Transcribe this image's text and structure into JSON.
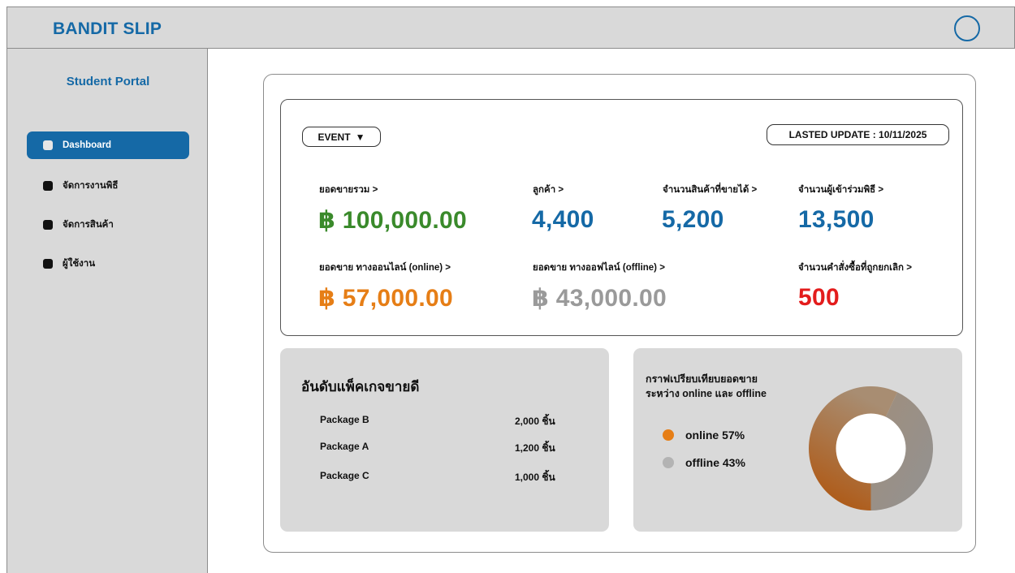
{
  "app": {
    "brand": "BANDIT SLIP"
  },
  "sidebar": {
    "title": "Student Portal",
    "items": [
      {
        "label": "Dashboard",
        "active": true
      },
      {
        "label": "จัดการงานพิธี",
        "active": false
      },
      {
        "label": "จัดการสินค้า",
        "active": false
      },
      {
        "label": "ผู้ใช้งาน",
        "active": false
      }
    ]
  },
  "dashboard": {
    "event_label": "EVENT",
    "event_arrow": "▼",
    "last_update": "LASTED UPDATE : 10/11/2025",
    "stats": {
      "total_sales": {
        "label": "ยอดขายรวม >",
        "value": "฿ 100,000.00",
        "color": "#3a8a2b"
      },
      "customers": {
        "label": "ลูกค้า >",
        "value": "4,400",
        "color": "#1569a6"
      },
      "products_sold": {
        "label": "จำนวนสินค้าที่ขายได้ >",
        "value": "5,200",
        "color": "#1569a6"
      },
      "attendees": {
        "label": "จำนวนผู้เข้าร่วมพิธี >",
        "value": "13,500",
        "color": "#1569a6"
      },
      "online_sales": {
        "label": "ยอดขาย ทางออนไลน์ (online) >",
        "value": "฿ 57,000.00",
        "color": "#e67e16"
      },
      "offline_sales": {
        "label": "ยอดขาย ทางออฟไลน์ (offline) >",
        "value": "฿ 43,000.00",
        "color": "#9a9a9a"
      },
      "cancelled_orders": {
        "label": "จำนวนคำสั่งซื้อที่ถูกยกเลิก >",
        "value": "500",
        "color": "#e31c1c"
      }
    },
    "top_packages": {
      "title": "อันดับแพ็คเกจขายดี",
      "rows": [
        {
          "name": "Package B",
          "qty": "2,000 ชิ้น"
        },
        {
          "name": "Package A",
          "qty": "1,200 ชิ้น"
        },
        {
          "name": "Package C",
          "qty": "1,000 ชิ้น"
        }
      ]
    },
    "comparison": {
      "title_line1": "กราฟเปรียบเทียบยอดขาย",
      "title_line2": "ระหว่าง online และ offline",
      "legend": [
        {
          "label": "online 57%",
          "color": "#e67e16"
        },
        {
          "label": "offline 43%",
          "color": "#b3b3b3"
        }
      ]
    }
  },
  "chart_data": {
    "type": "pie",
    "categories": [
      "online",
      "offline"
    ],
    "values": [
      57,
      43
    ],
    "colors": [
      "#b5590f",
      "#9a9a9a"
    ],
    "title": ""
  }
}
